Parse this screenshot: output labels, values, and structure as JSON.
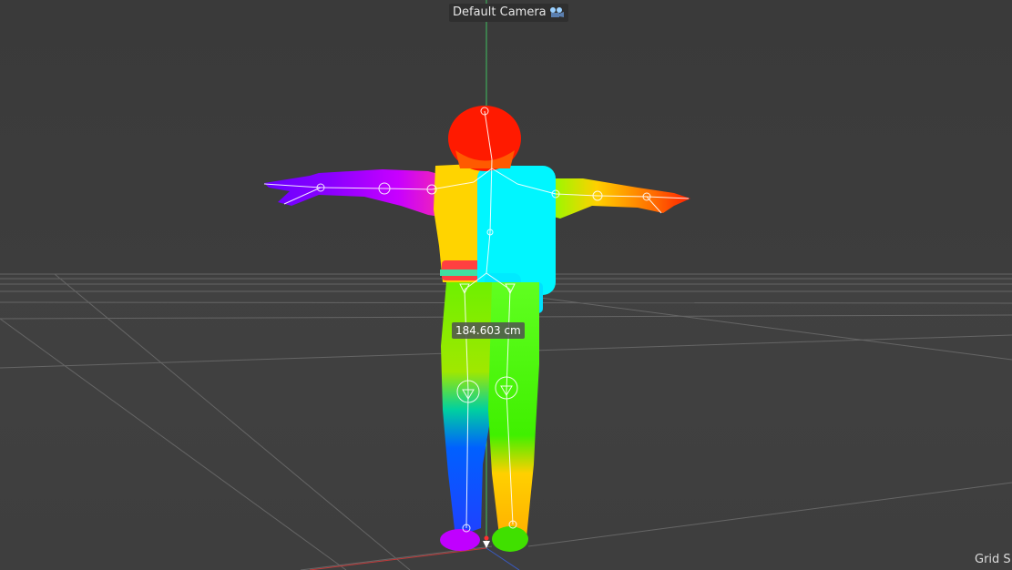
{
  "viewport": {
    "camera_label": "Default Camera",
    "camera_icon": "camera-icon",
    "measurement": "184.603 cm",
    "grid_label": "Grid S"
  },
  "colors": {
    "background": "#3c3c3c",
    "axis_x": "#c23a3a",
    "axis_y": "#3fbf5f",
    "axis_z": "#3a5ac2",
    "grid": "#6a6a6a"
  }
}
